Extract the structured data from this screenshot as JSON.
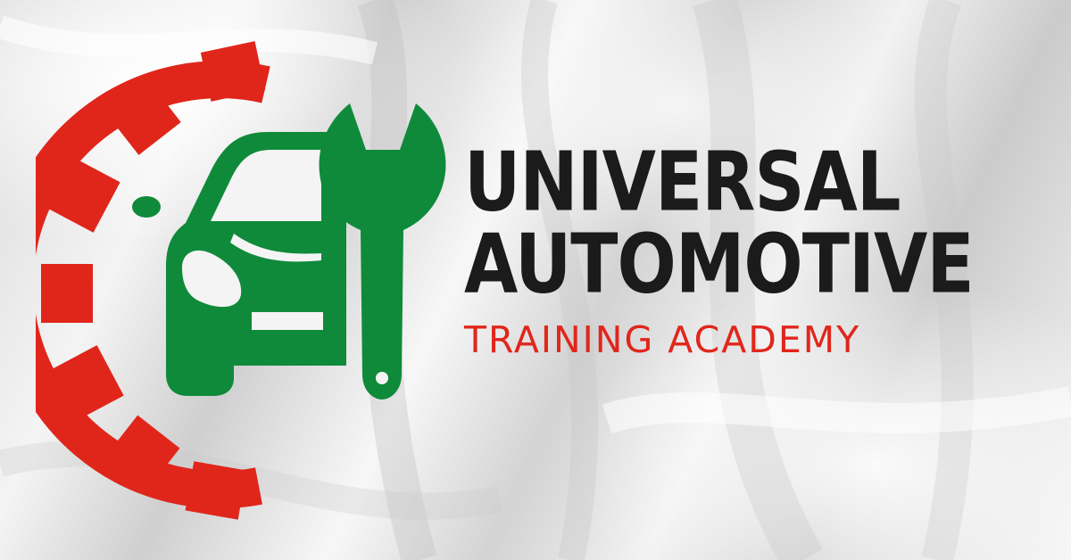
{
  "brand": {
    "line1": "UNIVERSAL",
    "line2": "AUTOMOTIVE",
    "line3": "TRAINING ACADEMY"
  },
  "colors": {
    "gear": "#e0261b",
    "car_and_wrench": "#0f8a3a",
    "title_text": "#1b1b1b",
    "subtitle_text": "#e0261b",
    "background": "#eeeeee"
  },
  "icons": [
    "gear-icon",
    "car-icon",
    "wrench-icon"
  ]
}
